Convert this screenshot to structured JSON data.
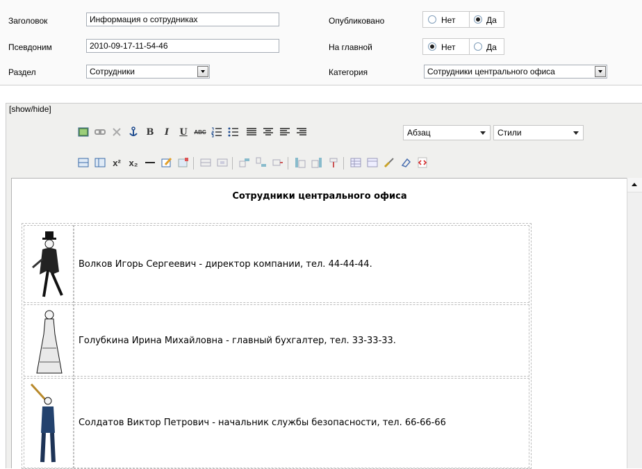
{
  "form": {
    "title_label": "Заголовок",
    "title_value": "Информация о сотрудниках",
    "alias_label": "Псевдоним",
    "alias_value": "2010-09-17-11-54-46",
    "section_label": "Раздел",
    "section_value": "Сотрудники",
    "published_label": "Опубликовано",
    "published_no": "Нет",
    "published_yes": "Да",
    "frontpage_label": "На главной",
    "frontpage_no": "Нет",
    "frontpage_yes": "Да",
    "category_label": "Категория",
    "category_value": "Сотрудники центрального офиса"
  },
  "editor": {
    "show_hide": "[show/hide]",
    "format_select": "Абзац",
    "styles_select": "Стили",
    "doc_title": "Сотрудники центрального офиса",
    "employees": [
      {
        "text": "Волков Игорь Сергеевич - директор компании, тел. 44-44-44."
      },
      {
        "text": "Голубкина Ирина Михайловна - главный бухгалтер, тел. 33-33-33."
      },
      {
        "text": "Солдатов Виктор Петрович - начальник службы безопасности, тел. 66-66-66"
      }
    ]
  }
}
